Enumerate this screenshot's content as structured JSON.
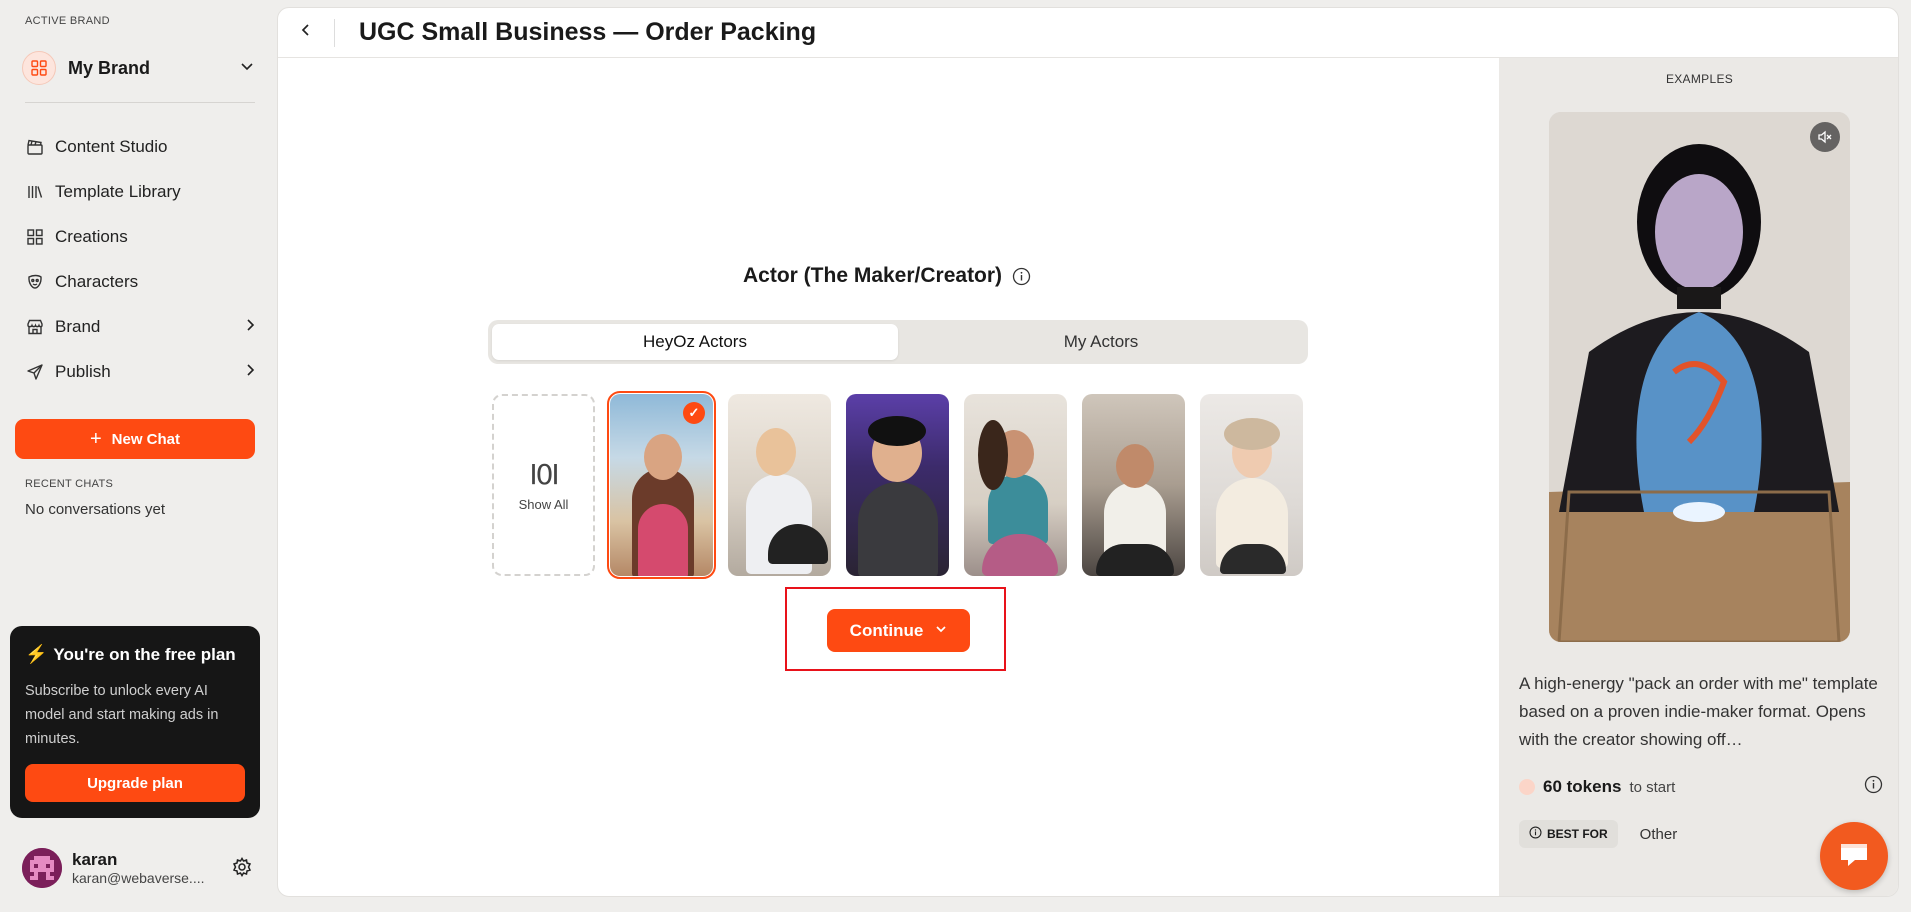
{
  "sidebar": {
    "active_brand_label": "ACTIVE BRAND",
    "brand_name": "My Brand",
    "nav": [
      {
        "label": "Content Studio",
        "icon": "clapperboard-icon"
      },
      {
        "label": "Template Library",
        "icon": "library-icon"
      },
      {
        "label": "Creations",
        "icon": "grid-icon"
      },
      {
        "label": "Characters",
        "icon": "mask-icon"
      },
      {
        "label": "Brand",
        "icon": "store-icon"
      },
      {
        "label": "Publish",
        "icon": "send-icon"
      }
    ],
    "new_chat_label": "New Chat",
    "recent_chats_label": "RECENT CHATS",
    "recent_chats_empty": "No conversations yet",
    "plan": {
      "title": "You're on the free plan",
      "description": "Subscribe to unlock every AI model and start making ads in minutes.",
      "upgrade_label": "Upgrade plan"
    },
    "user": {
      "name": "karan",
      "email": "karan@webaverse...."
    }
  },
  "header": {
    "title": "UGC Small Business — Order Packing"
  },
  "step": {
    "title": "Actor (The Maker/Creator)",
    "tabs": [
      {
        "label": "HeyOz Actors",
        "active": true
      },
      {
        "label": "My Actors",
        "active": false
      }
    ],
    "show_all_label": "Show All",
    "actors": [
      {
        "id": "actor-1",
        "selected": true
      },
      {
        "id": "actor-2",
        "selected": false
      },
      {
        "id": "actor-3",
        "selected": false
      },
      {
        "id": "actor-4",
        "selected": false
      },
      {
        "id": "actor-5",
        "selected": false
      },
      {
        "id": "actor-6",
        "selected": false
      }
    ],
    "continue_label": "Continue"
  },
  "examples": {
    "label": "EXAMPLES",
    "description": "A high-energy \"pack an order with me\" template based on a proven indie-maker format. Opens with the creator showing off…",
    "tokens": "60 tokens",
    "tokens_suffix": "to start",
    "best_for_label": "BEST FOR",
    "best_for_value": "Other"
  },
  "colors": {
    "accent": "#fe4a12",
    "highlight": "#e8121a"
  }
}
